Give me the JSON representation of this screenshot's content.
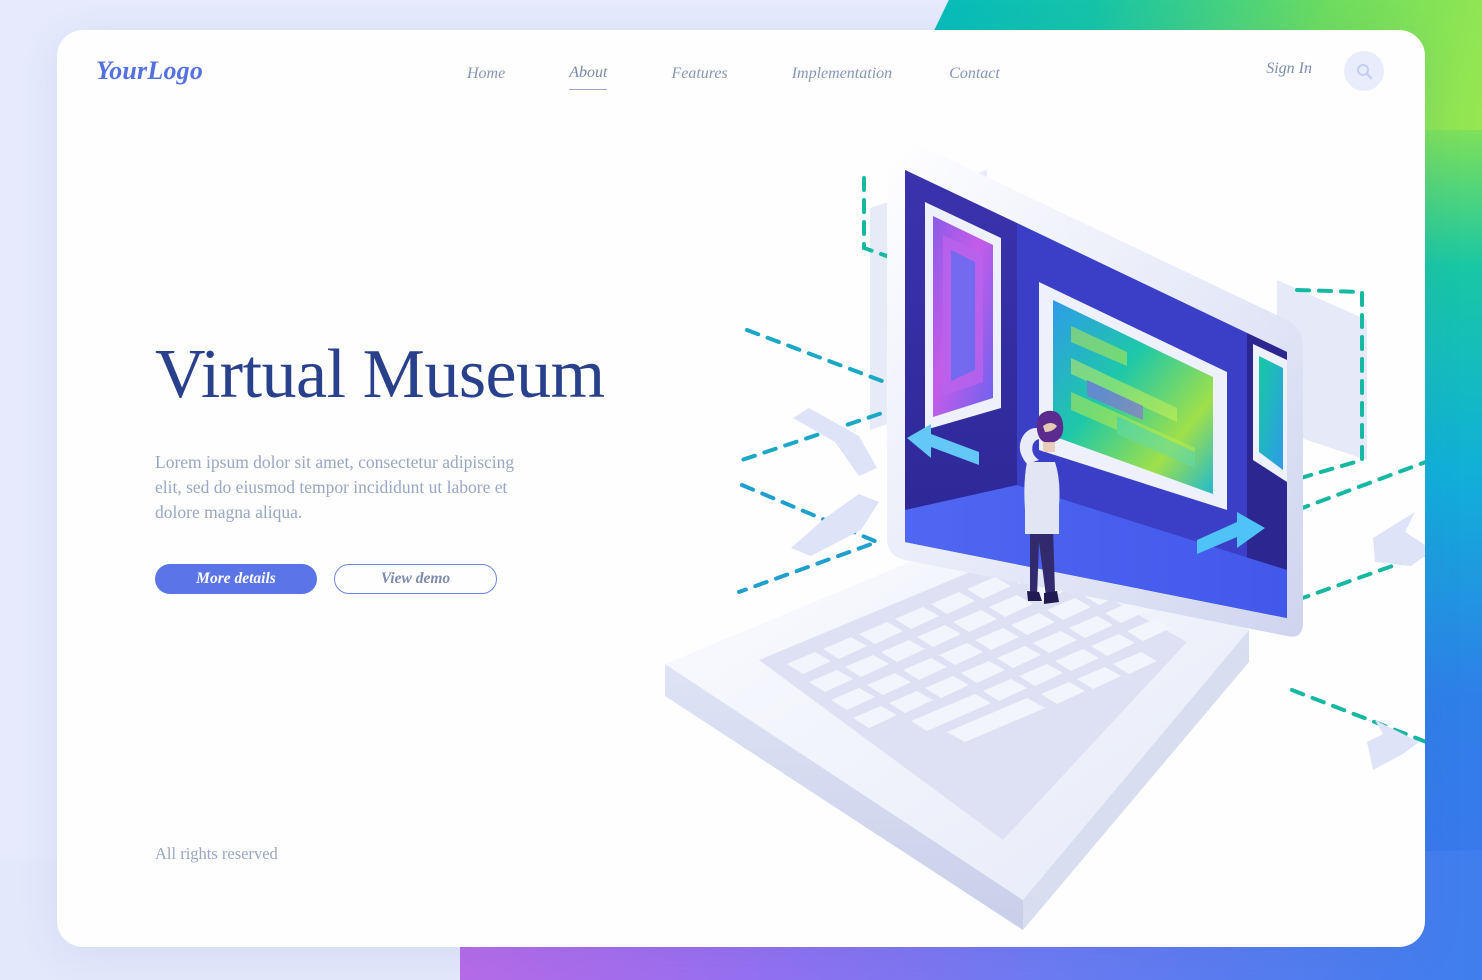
{
  "page": {
    "background_colors": {
      "outer": "#e6eafc",
      "card": "#fefeff",
      "top_right_gradient": [
        "#00b8c4",
        "#9ae84f"
      ],
      "right_gradient": [
        "#7ee05a",
        "#3b78ec"
      ],
      "bottom_right_gradient": [
        "#c06ae6",
        "#3f7eee"
      ]
    }
  },
  "header": {
    "logo": "YourLogo",
    "nav": [
      {
        "label": "Home",
        "active": false
      },
      {
        "label": "About",
        "active": true
      },
      {
        "label": "Features",
        "active": false
      },
      {
        "label": "Implementation",
        "active": false
      },
      {
        "label": "Contact",
        "active": false
      }
    ],
    "sign_in": "Sign In",
    "search_icon": "search-icon"
  },
  "hero": {
    "title": "Virtual Museum",
    "description": "Lorem ipsum dolor sit amet, consectetur adipiscing elit, sed do eiusmod tempor incididunt ut labore et dolore magna aliqua.",
    "primary_button": "More details",
    "secondary_button": "View demo",
    "accent_color": "#5b74e8",
    "title_color": "#29408c"
  },
  "footer": {
    "copyright": "All rights reserved"
  },
  "illustration": {
    "name": "isometric-laptop-virtual-museum",
    "description": "Isometric open laptop whose screen is a virtual museum gallery room with three framed artworks, a visitor standing inside, navigation arrows, dashed teal guide lines and floating lavender arrows.",
    "elements": [
      {
        "name": "laptop-base",
        "color": "#eef0fb"
      },
      {
        "name": "laptop-keyboard",
        "color": "#e2e5f6"
      },
      {
        "name": "laptop-screen",
        "color": "#3b3fc0"
      },
      {
        "name": "gallery-wall-left",
        "color": "#322a9e"
      },
      {
        "name": "gallery-floor",
        "color": "#4b62f0"
      },
      {
        "name": "artwork-left",
        "colors": [
          "#c060e8",
          "#7a5ce8",
          "#5c6ef0"
        ]
      },
      {
        "name": "artwork-center",
        "colors": [
          "#1ec8a8",
          "#b8e84a",
          "#8a5ce8",
          "#2f9be8"
        ]
      },
      {
        "name": "artwork-right",
        "colors": [
          "#19c7a4",
          "#2f9be8"
        ]
      },
      {
        "name": "visitor-figure",
        "colors": [
          "#e4e7f5",
          "#3a2a72",
          "#5a2a8c"
        ]
      },
      {
        "name": "nav-arrow-left",
        "color": "#63c8f5"
      },
      {
        "name": "nav-arrow-right",
        "color": "#4fc3f7"
      },
      {
        "name": "dashed-guide-lines",
        "color": "#18b8a0"
      },
      {
        "name": "floating-arrows",
        "color": "#dfe3f8"
      }
    ]
  }
}
